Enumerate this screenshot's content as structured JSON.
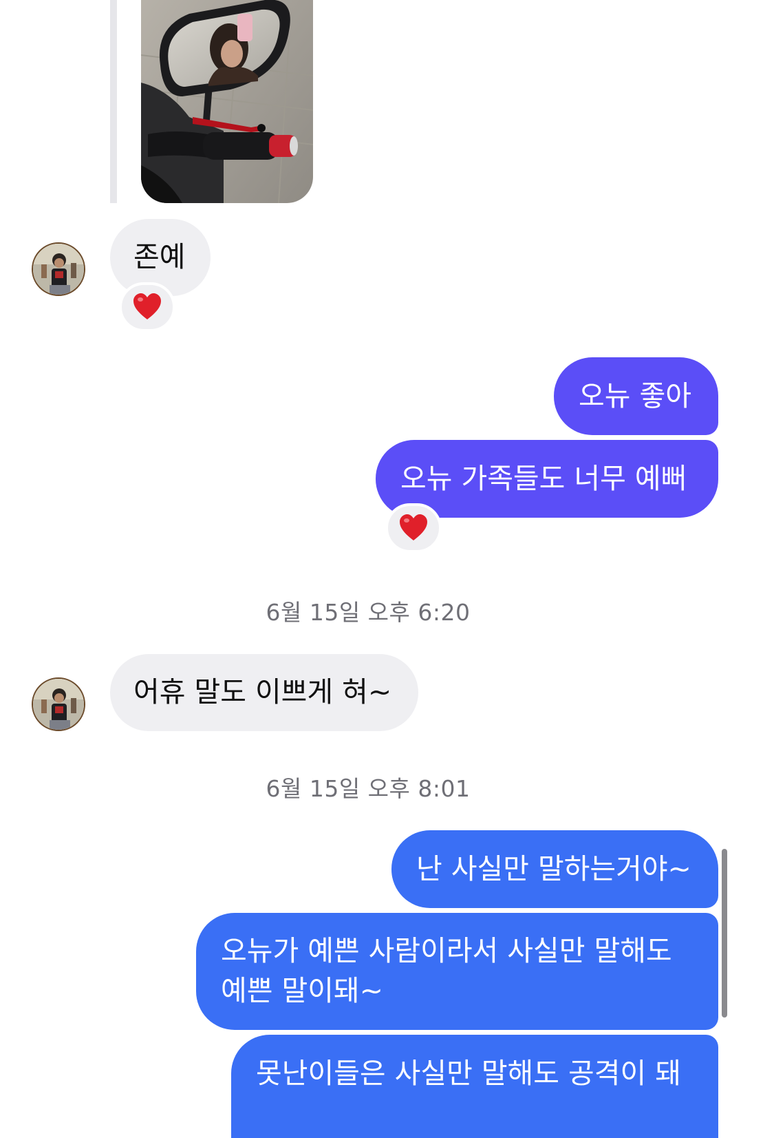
{
  "thread": {
    "messages": [
      {
        "id": "m1",
        "sender": "them",
        "text": "존예",
        "reaction": "heart"
      },
      {
        "id": "m2",
        "sender": "me",
        "text": "오뉴 좋아"
      },
      {
        "id": "m3",
        "sender": "me",
        "text": "오뉴 가족들도 너무 예뻐",
        "reaction": "heart"
      },
      {
        "id": "t1",
        "type": "timestamp",
        "text": "6월 15일 오후 6:20"
      },
      {
        "id": "m4",
        "sender": "them",
        "text": "어휴 말도 이쁘게 혀~"
      },
      {
        "id": "t2",
        "type": "timestamp",
        "text": "6월 15일 오후 8:01"
      },
      {
        "id": "m5",
        "sender": "me",
        "text": "난 사실만 말하는거야~"
      },
      {
        "id": "m6",
        "sender": "me",
        "text": "오뉴가 예쁜 사람이라서 사실만 말해도 예쁜 말이돼~",
        "lines": [
          "오뉴가 예쁜 사람이라서 사실만 말해도",
          "예쁜 말이돼~"
        ]
      },
      {
        "id": "m7",
        "sender": "me",
        "text": "못난이들은 사실만 말해도 공격이 돼"
      }
    ]
  },
  "icons": {
    "reaction": "heart-emoji",
    "avatar": "avatar-photo",
    "shared_image": "mirror-selfie-photo"
  },
  "colors": {
    "received_bubble": "#efeff2",
    "sent_purple": "#5b4ef7",
    "sent_blue": "#3a6ff5",
    "timestamp_text": "#6f6f76",
    "heart": "#e0202a"
  }
}
